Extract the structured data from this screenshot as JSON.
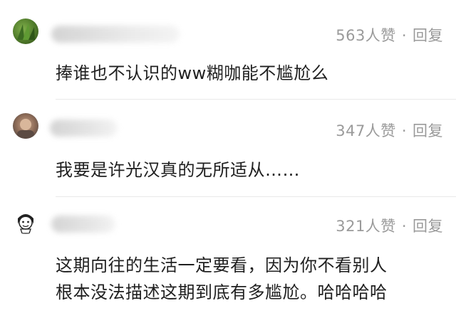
{
  "comments": [
    {
      "likes": "563人赞",
      "separator": "·",
      "reply": "回复",
      "text": "捧谁也不认识的ww糊咖能不尴尬么"
    },
    {
      "likes": "347人赞",
      "separator": "·",
      "reply": "回复",
      "text": "我要是许光汉真的无所适从……"
    },
    {
      "likes": "321人赞",
      "separator": "·",
      "reply": "回复",
      "text_line1": "这期向往的生活一定要看，因为你不看别人",
      "text_line2": "根本没法描述这期到底有多尴尬。哈哈哈哈"
    }
  ],
  "colors": {
    "meta_gray": "#9a9a9a",
    "divider": "#e9e9e9",
    "text": "#1f1f1f"
  }
}
